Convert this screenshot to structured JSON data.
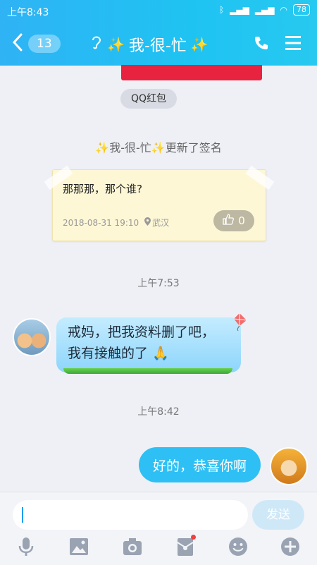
{
  "status_bar": {
    "time": "上午8:43",
    "battery": "78"
  },
  "header": {
    "back_count": "13",
    "title": "我-很-忙",
    "icons": [
      "back-chevron-icon",
      "ear-icon",
      "sparkle-icon",
      "phone-icon",
      "menu-icon"
    ]
  },
  "chat": {
    "red_packet_label": "QQ红包",
    "signature_update": {
      "name": "我-很-忙",
      "text": "更新了签名"
    },
    "signature_card": {
      "text": "那那那，那个谁?",
      "date": "2018-08-31 19:10",
      "location": "武汉",
      "likes": "0"
    },
    "timestamps": [
      "上午7:53",
      "上午8:42"
    ],
    "incoming_message": {
      "line1": "戒妈，把我资料删了吧，",
      "line2": "我有接触的了"
    },
    "outgoing_message": {
      "text": "好的，恭喜你啊"
    }
  },
  "input_bar": {
    "send_label": "发送",
    "toolbar_icons": [
      "microphone-icon",
      "image-icon",
      "camera-icon",
      "red-packet-icon",
      "emoji-icon",
      "plus-icon"
    ]
  },
  "colors": {
    "header_bar": "#22bbf3",
    "outgoing_bubble": "#2ec0f4",
    "incoming_bubble": "#a8e0fc",
    "sparkle": "#ffe14d",
    "red_card": "#e8233f"
  }
}
